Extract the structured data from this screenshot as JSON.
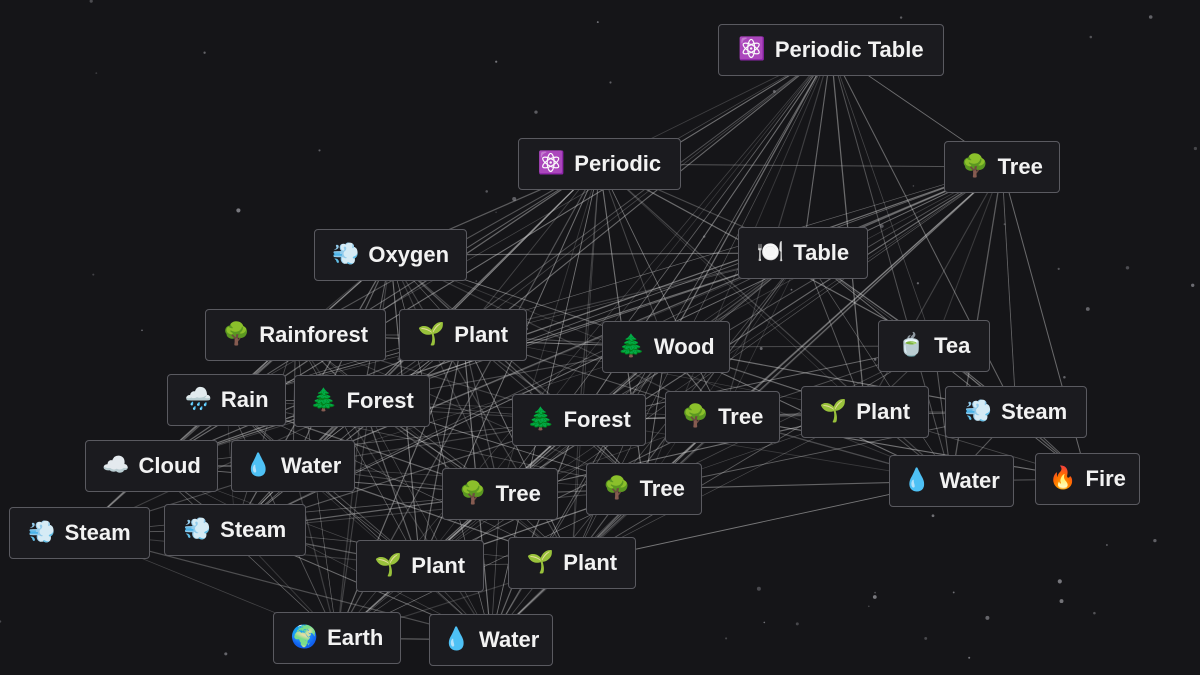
{
  "colors": {
    "background": "#151518",
    "node_background": "#1b1b1f",
    "node_border": "#5a5a60",
    "link": "#d8d8d8",
    "star": "#8a8a90"
  },
  "nodes": [
    {
      "id": "periodic-table",
      "label": "Periodic Table",
      "icon": "⚛️",
      "icon_name": "atom-icon"
    },
    {
      "id": "periodic",
      "label": "Periodic",
      "icon": "⚛️",
      "icon_name": "atom-icon"
    },
    {
      "id": "tree-1",
      "label": "Tree",
      "icon": "🌳",
      "icon_name": "tree-icon"
    },
    {
      "id": "oxygen",
      "label": "Oxygen",
      "icon": "💨",
      "icon_name": "wind-icon"
    },
    {
      "id": "table",
      "label": "Table",
      "icon": "🍽️",
      "icon_name": "plate-icon"
    },
    {
      "id": "rainforest",
      "label": "Rainforest",
      "icon": "🌳",
      "icon_name": "tree-icon"
    },
    {
      "id": "plant-1",
      "label": "Plant",
      "icon": "🌱",
      "icon_name": "seedling-icon"
    },
    {
      "id": "wood",
      "label": "Wood",
      "icon": "🌲",
      "icon_name": "evergreen-tree-icon"
    },
    {
      "id": "tea",
      "label": "Tea",
      "icon": "🍵",
      "icon_name": "tea-icon"
    },
    {
      "id": "rain",
      "label": "Rain",
      "icon": "🌧️",
      "icon_name": "rain-cloud-icon"
    },
    {
      "id": "forest-1",
      "label": "Forest",
      "icon": "🌲",
      "icon_name": "evergreen-tree-icon"
    },
    {
      "id": "forest-2",
      "label": "Forest",
      "icon": "🌲",
      "icon_name": "evergreen-tree-icon"
    },
    {
      "id": "tree-2",
      "label": "Tree",
      "icon": "🌳",
      "icon_name": "tree-icon"
    },
    {
      "id": "plant-2",
      "label": "Plant",
      "icon": "🌱",
      "icon_name": "seedling-icon"
    },
    {
      "id": "steam-1",
      "label": "Steam",
      "icon": "💨",
      "icon_name": "wind-icon"
    },
    {
      "id": "cloud",
      "label": "Cloud",
      "icon": "☁️",
      "icon_name": "cloud-icon"
    },
    {
      "id": "water-1",
      "label": "Water",
      "icon": "💧",
      "icon_name": "droplet-icon"
    },
    {
      "id": "tree-3",
      "label": "Tree",
      "icon": "🌳",
      "icon_name": "tree-icon"
    },
    {
      "id": "tree-4",
      "label": "Tree",
      "icon": "🌳",
      "icon_name": "tree-icon"
    },
    {
      "id": "water-2",
      "label": "Water",
      "icon": "💧",
      "icon_name": "droplet-icon"
    },
    {
      "id": "fire",
      "label": "Fire",
      "icon": "🔥",
      "icon_name": "fire-icon"
    },
    {
      "id": "steam-2",
      "label": "Steam",
      "icon": "💨",
      "icon_name": "wind-icon"
    },
    {
      "id": "steam-3",
      "label": "Steam",
      "icon": "💨",
      "icon_name": "wind-icon"
    },
    {
      "id": "plant-3",
      "label": "Plant",
      "icon": "🌱",
      "icon_name": "seedling-icon"
    },
    {
      "id": "plant-4",
      "label": "Plant",
      "icon": "🌱",
      "icon_name": "seedling-icon"
    },
    {
      "id": "earth",
      "label": "Earth",
      "icon": "🌍",
      "icon_name": "globe-icon"
    },
    {
      "id": "water-3",
      "label": "Water",
      "icon": "💧",
      "icon_name": "droplet-icon"
    }
  ]
}
